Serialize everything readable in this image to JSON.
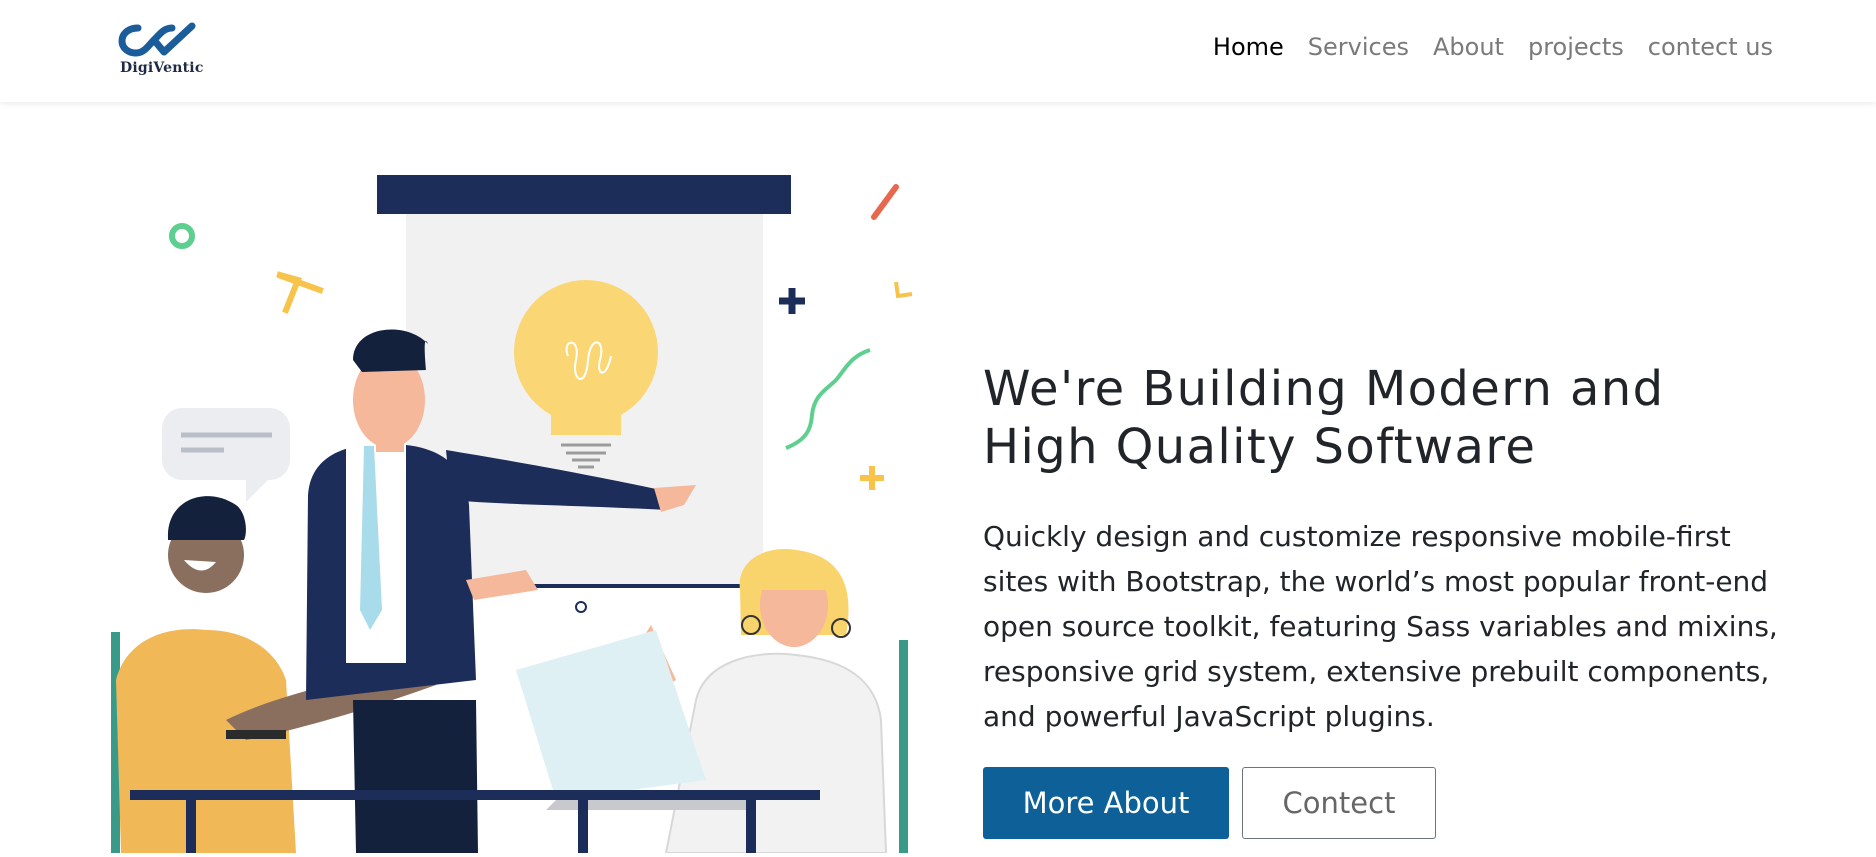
{
  "brand": {
    "name": "DigiVentic",
    "logo_icon": "infinity-check-logo"
  },
  "nav": {
    "items": [
      {
        "label": "Home",
        "active": true
      },
      {
        "label": "Services",
        "active": false
      },
      {
        "label": "About",
        "active": false
      },
      {
        "label": "projects",
        "active": false
      },
      {
        "label": "contect us",
        "active": false
      }
    ]
  },
  "hero": {
    "title": "We're Building Modern and High Quality Software",
    "description": "Quickly design and customize responsive mobile-first sites with Bootstrap, the world’s most popular front-end open source toolkit, featuring Sass variables and mixins, responsive grid system, extensive prebuilt components, and powerful JavaScript plugins.",
    "primary_button": "More About",
    "secondary_button": "Contect",
    "illustration": "team-presentation-illustration"
  },
  "colors": {
    "primary": "#0d6198",
    "navy": "#1d2d5a",
    "yellow": "#f7c34a",
    "nav_active": "#000000",
    "nav_inactive": "#7a7a7a"
  }
}
